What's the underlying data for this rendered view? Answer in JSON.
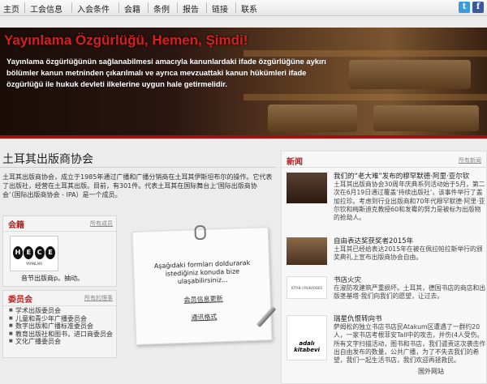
{
  "nav": {
    "items": [
      "主页",
      "工会信息",
      "入会条件",
      "会籍",
      "条例",
      "报告",
      "链接",
      "联系"
    ],
    "twitter_glyph": "t",
    "facebook_glyph": "f"
  },
  "banner": {
    "title": "Yayınlama Özgürlüğü, Hemen, Şimdi!",
    "text": "Yayınlama özgürlüğünün sağlanabilmesi  amacıyla kanunlardaki ifade özgürlüğüne aykırı bölümler kanun metninden çıkarılmalı ve ayrıca mevzuattaki kanun hükümleri ifade özgürlüğü ile hukuk devleti ilkelerine uygun hale getirmelidir."
  },
  "main": {
    "title": "土耳其出版商协会",
    "intro": "土耳其出版商协会，成立于1985年通过广播和广播分销商在土耳其伊斯坦布尔的操作。它代表了出版社，经营在土耳其出版。目前，有301件。代表土耳其在国际舞台上‘国际出版商协会’（国际出版商协会 - IPA）是一个成员。"
  },
  "membership": {
    "heading": "会籍",
    "all_link": "所有成员",
    "logo_letters": [
      "H",
      "E",
      "C",
      "E"
    ],
    "logo_sub": "YAYINLARI",
    "caption": "音节出版商p。抽动。"
  },
  "committees": {
    "heading": "委员会",
    "all_link": "所有的理事",
    "items": [
      "学术出版委员会",
      "儿童和青少年广播委员会",
      "数字出版和广播标准委员会",
      "教育出版社和图书，进口商委员会",
      "文化广播委员会"
    ]
  },
  "paper": {
    "text": "Aşağıdaki formları doldurarak istediğiniz konuda bize ulaşabilirsiniz...",
    "link1": "会员信息更新",
    "link2": "通讯格式"
  },
  "news": {
    "heading": "新闻",
    "all_link": "所有新闻",
    "items": [
      {
        "title": "我们的“老大难”发布的穆罕默德·阿里·亚尔钦",
        "body": "土耳其出版商协会30周年庆典系列活动始于5月，第二次在6月19日通过覆盖‘持续出版社’，该事件举行了盖加拉珍。考虑到行业出版商和70年代穆罕默德·阿里·亚尔钦和梅斯迪克教授60和发霉的努力是被标为出版物的抢劫人。"
      },
      {
        "title": "自由表达奖获奖者2015年",
        "body": "土耳其已经给表达2015年在被在佩拉帕拉斯举行的颁奖典礼上宣布出版商协会自由。"
      },
      {
        "title": "书店火灾",
        "body": "在淑防攻建筑严重损坏。土耳其，德国书店的商店和出版茎基塔·我们向我们的愿望，让过去。"
      },
      {
        "title": "瑞星仇恨转向书",
        "body": "萨姆松的独立书店书店民Atakum区遭遇了一群约20人，一家书店考根菲安Tall中的攻击，并伤(4人受伤。所有文字扫描活动，图书和书店，我们谴责这次袭击作出自由发布的数量，公共广播，为了不失去我们的希望，我们一起生活书店，我们欢迎再拯救民。"
      }
    ],
    "thumb2_caption": "KİTAB-I MUKADDES ŞİRKETİ",
    "thumb3_text": "adalı kitabevi",
    "footer_link": "国外网站"
  },
  "colors": {
    "accent": "#b32222",
    "banner_red": "#d42020"
  }
}
